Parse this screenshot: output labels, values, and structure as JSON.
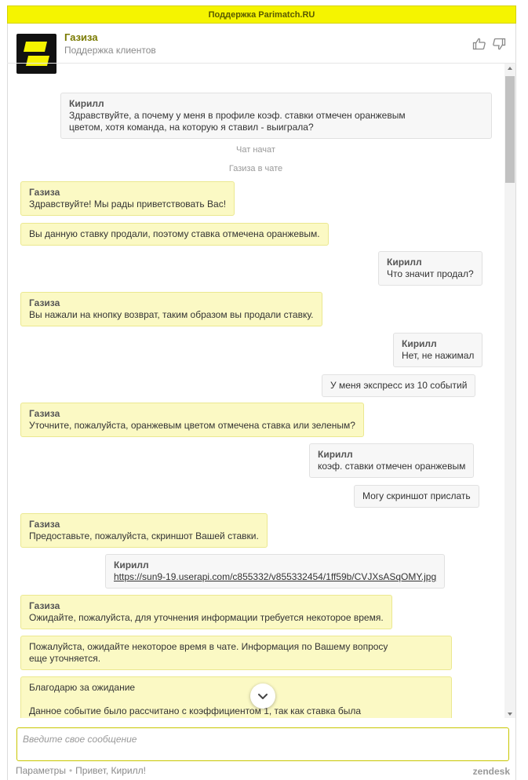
{
  "topbar": {
    "title": "Поддержка Parimatch.RU"
  },
  "header": {
    "agent_name": "Газиза",
    "agent_subtitle": "Поддержка клиентов"
  },
  "messages": [
    {
      "who": "Кирилл",
      "text_1": "Здравствуйте, а почему у меня в профиле коэф. ставки отмечен оранжевым",
      "text_2": "цветом, хотя команда, на которую я ставил - выиграла?"
    },
    {
      "text": "Чат начат"
    },
    {
      "text": "Газиза в чате"
    },
    {
      "who": "Газиза",
      "text": "Здравствуйте! Мы рады приветствовать Вас!"
    },
    {
      "text": "Вы данную ставку продали, поэтому ставка отмечена оранжевым."
    },
    {
      "who": "Кирилл",
      "text": "Что значит продал?"
    },
    {
      "who": "Газиза",
      "text": "Вы нажали на кнопку возврат, таким образом вы продали ставку."
    },
    {
      "who": "Кирилл",
      "text": "Нет, не нажимал"
    },
    {
      "text": "У меня экспресс из 10 событий"
    },
    {
      "who": "Газиза",
      "text": "Уточните, пожалуйста, оранжевым цветом отмечена ставка или зеленым?"
    },
    {
      "who": "Кирилл",
      "text": "коэф. ставки отмечен оранжевым"
    },
    {
      "text": "Могу скриншот прислать"
    },
    {
      "who": "Газиза",
      "text": "Предоставьте, пожалуйста, скриншот Вашей ставки."
    },
    {
      "who": "Кирилл",
      "link": "https://sun9-19.userapi.com/c855332/v855332454/1ff59b/CVJXsASqOMY.jpg"
    },
    {
      "who": "Газиза",
      "text": "Ожидайте, пожалуйста, для уточнения информации требуется некоторое время."
    },
    {
      "text_1": "Пожалуйста, ожидайте некоторое время в чате. Информация по Вашему вопросу",
      "text_2": "еще уточняется."
    },
    {
      "text_1": "Благодарю за ожидание",
      "text_2": "Данное событие было рассчитано с коэффициентом 1, так как ставка была"
    }
  ],
  "composer": {
    "placeholder": "Введите свое сообщение"
  },
  "footer": {
    "settings": "Параметры",
    "greeting": "Привет, Кирилл!",
    "brand": "zendesk"
  },
  "colors": {
    "accent": "#f5f400",
    "agent_bubble": "#fbf9c4",
    "user_bubble": "#f7f7f7"
  },
  "icons": {
    "rate_up": "thumbs-up-icon",
    "rate_down": "thumbs-down-icon",
    "scroll_down": "chevron-down-icon"
  }
}
